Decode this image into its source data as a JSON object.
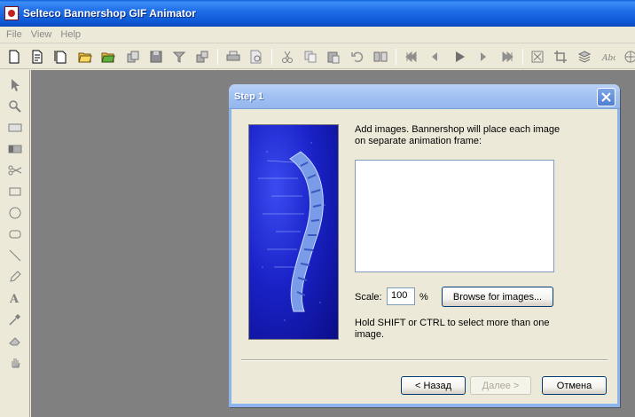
{
  "window": {
    "title": "Selteco Bannershop GIF Animator"
  },
  "menu": {
    "items": [
      "File",
      "View",
      "Help"
    ]
  },
  "dialog": {
    "title": "Step 1",
    "instructions": "Add images. Bannershop will place each image on separate animation frame:",
    "scale_label": "Scale:",
    "scale_value": "100",
    "percent_sign": "%",
    "browse_label": "Browse for images...",
    "hint": "Hold SHIFT or CTRL to select more than one image.",
    "back_label": "< Назад",
    "next_label": "Далее >",
    "cancel_label": "Отмена"
  },
  "colors": {
    "titlebar": "#0c56d4",
    "workspace": "#808080",
    "dialog_frame": "#8eb4f0",
    "face": "#ece9d8"
  }
}
